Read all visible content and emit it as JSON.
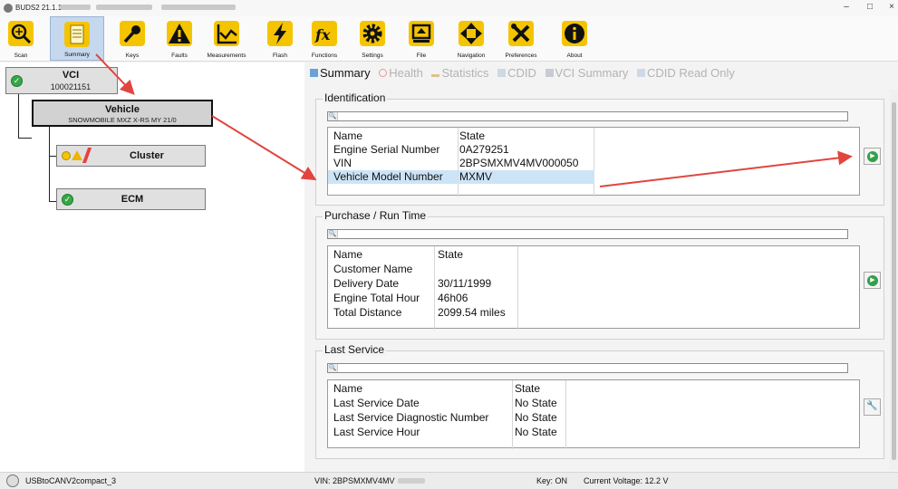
{
  "window": {
    "title": "BUDS2 21.1.1",
    "minimize_glyph": "–",
    "maximize_glyph": "□",
    "close_glyph": "×"
  },
  "toolbar": [
    {
      "label": "Scan",
      "icon": "scan-icon"
    },
    {
      "label": "Summary",
      "icon": "summary-icon",
      "active": true
    },
    {
      "label": "Keys",
      "icon": "key-icon"
    },
    {
      "label": "Faults",
      "icon": "warning-icon"
    },
    {
      "label": "Measurements",
      "icon": "graph-icon"
    },
    {
      "label": "Flash",
      "icon": "lightning-icon"
    },
    {
      "label": "Functions",
      "icon": "fx-icon"
    },
    {
      "label": "Settings",
      "icon": "gear-icon"
    },
    {
      "label": "File",
      "icon": "file-icon"
    },
    {
      "label": "Navigation",
      "icon": "navigation-icon"
    },
    {
      "label": "Preferences",
      "icon": "tools-icon"
    },
    {
      "label": "About",
      "icon": "info-icon"
    }
  ],
  "tree": {
    "vci": {
      "title": "VCI",
      "subtitle": "100021151"
    },
    "vehicle": {
      "title": "Vehicle",
      "subtitle": "SNOWMOBILE MXZ X-RS MY 21/0"
    },
    "cluster": {
      "title": "Cluster"
    },
    "ecm": {
      "title": "ECM"
    }
  },
  "tabs": [
    {
      "label": "Summary",
      "active": true
    },
    {
      "label": "Health"
    },
    {
      "label": "Statistics"
    },
    {
      "label": "CDID"
    },
    {
      "label": "VCI Summary"
    },
    {
      "label": "CDID Read Only"
    }
  ],
  "identification": {
    "title": "Identification",
    "header": [
      "Name",
      "State"
    ],
    "rows": [
      [
        "Engine Serial Number",
        "0A279251"
      ],
      [
        "VIN",
        "2BPSMXMV4MV000050"
      ],
      [
        "Vehicle Model Number",
        "MXMV"
      ]
    ]
  },
  "purchase": {
    "title": "Purchase / Run Time",
    "header": [
      "Name",
      "State"
    ],
    "rows": [
      [
        "Customer Name",
        ""
      ],
      [
        "Delivery Date",
        "30/11/1999"
      ],
      [
        "Engine Total Hour",
        "46h06"
      ],
      [
        "Total Distance",
        "2099.54 miles"
      ]
    ]
  },
  "last_service": {
    "title": "Last Service",
    "header": [
      "Name",
      "State"
    ],
    "rows": [
      [
        "Last Service Date",
        "No State"
      ],
      [
        "Last Service Diagnostic Number",
        "No State"
      ],
      [
        "Last Service Hour",
        "No State"
      ]
    ]
  },
  "statusbar": {
    "adapter": "USBtoCANV2compact_3",
    "vin": "VIN: 2BPSMXMV4MV",
    "key": "Key: ON",
    "voltage": "Current Voltage: 12.2 V"
  },
  "colors": {
    "annotation_arrow": "#e0463f",
    "status_ok": "#35a845",
    "selected_row": "#cde4f7",
    "active_tab_bg": "#c6d8ee"
  }
}
